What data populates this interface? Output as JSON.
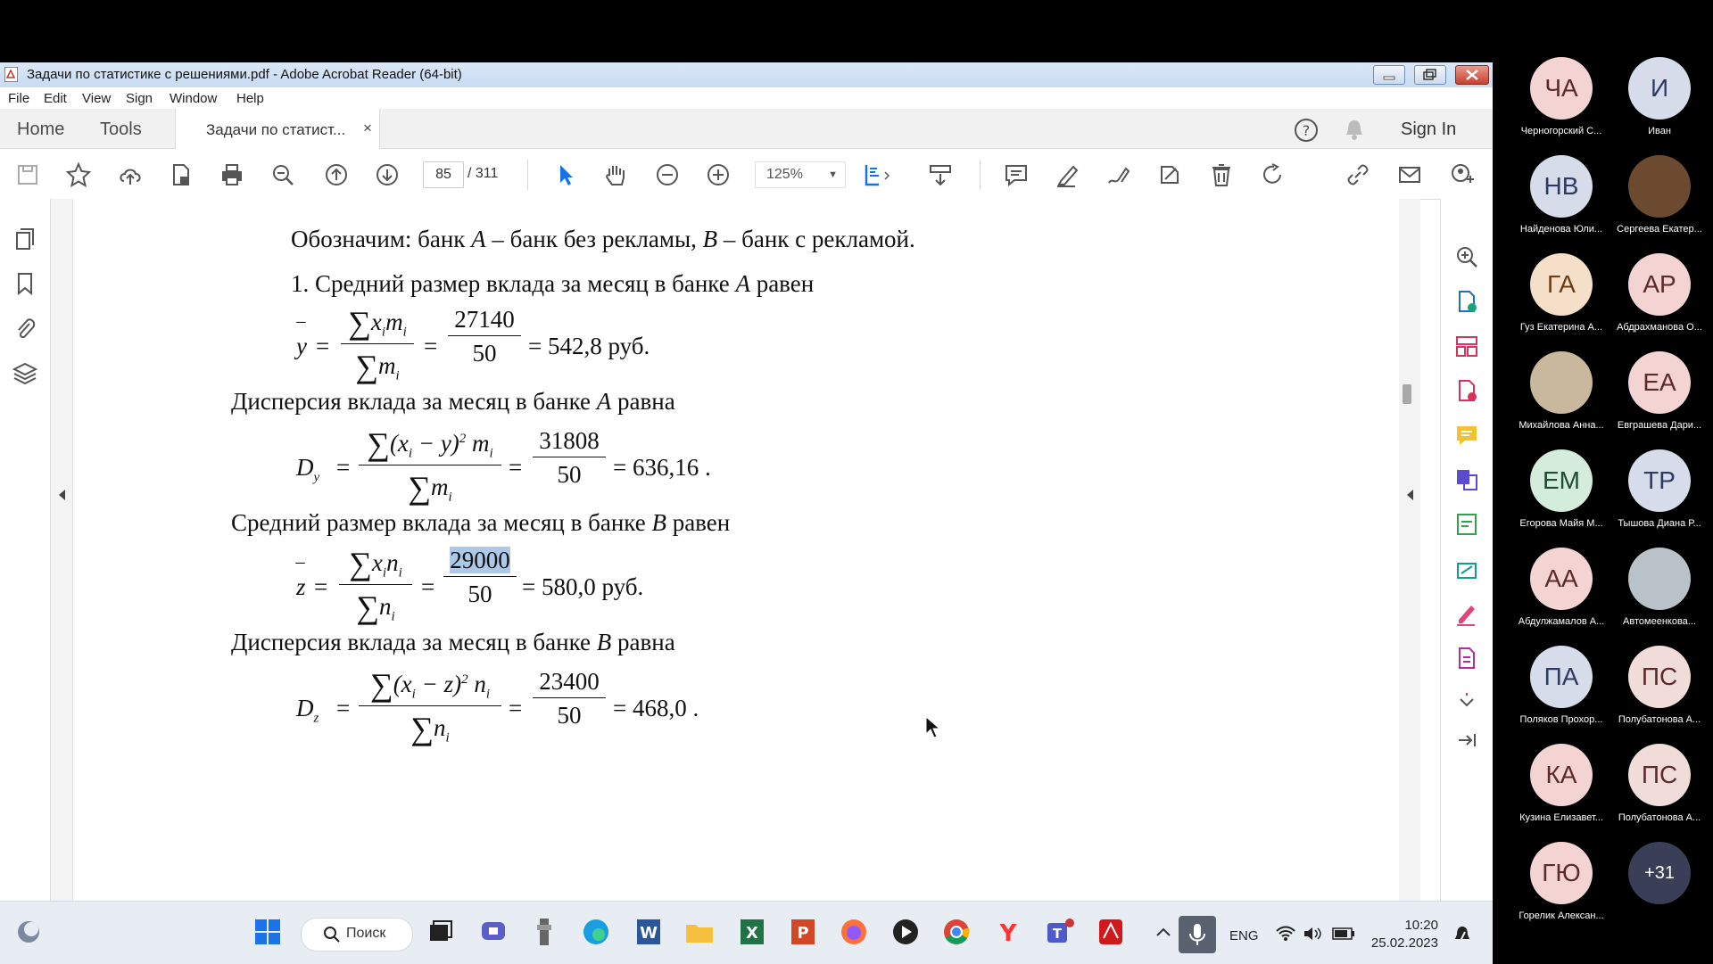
{
  "window": {
    "title": "Задачи по статистике с решениями.pdf - Adobe Acrobat Reader (64-bit)"
  },
  "menu": [
    "File",
    "Edit",
    "View",
    "Sign",
    "Window",
    "Help"
  ],
  "tabs": {
    "home": "Home",
    "tools": "Tools",
    "document": "Задачи по статист...",
    "close": "×",
    "sign_in": "Sign In"
  },
  "toolbar": {
    "page_current": "85",
    "page_total": "/  311",
    "zoom": "125%"
  },
  "document": {
    "line1_a": "Обозначим: банк ",
    "line1_A": "A",
    "line1_b": " – банк без рекламы, ",
    "line1_B": "B",
    "line1_c": " – банк с рекламой.",
    "line2_a": "1. Средний размер вклада за месяц в банке ",
    "line2_A": "A",
    "line2_b": " равен",
    "f1_result": "= 542,8  руб.",
    "f1_num": "27140",
    "f1_den": "50",
    "line3_a": "Дисперсия вклада за месяц в банке ",
    "line3_A": "A",
    "line3_b": " равна",
    "f2_num": "31808",
    "f2_den": "50",
    "f2_result": "= 636,16 .",
    "line4_a": "Средний размер вклада за месяц в банке ",
    "line4_B": "B",
    "line4_b": " равен",
    "f3_num": "29000",
    "f3_den": "50",
    "f3_result": "= 580,0  руб.",
    "line5_a": "Дисперсия вклада за месяц в банке ",
    "line5_B": "B",
    "line5_b": " равна",
    "f4_num": "23400",
    "f4_den": "50",
    "f4_result": "= 468,0 ."
  },
  "taskbar": {
    "search": "Поиск",
    "lang": "ENG",
    "time": "10:20",
    "date": "25.02.2023"
  },
  "participants": [
    {
      "initials": "ЧА",
      "name": "Черногорский С...",
      "color": "#f4d3d3"
    },
    {
      "initials": "И",
      "name": "Иван",
      "color": "#d6dcea"
    },
    {
      "initials": "НВ",
      "name": "Найденова Юли...",
      "color": "#d6dcea"
    },
    {
      "initials": "",
      "name": "Сергеева Екатер...",
      "color": "#6b4a2f"
    },
    {
      "initials": "ГА",
      "name": "Гуз Екатерина А...",
      "color": "#f6dfc8"
    },
    {
      "initials": "АР",
      "name": "Абдрахманова О...",
      "color": "#f4d3d3"
    },
    {
      "initials": "",
      "name": "Михайлова Анна...",
      "color": "#c9b89e"
    },
    {
      "initials": "ЕА",
      "name": "Евграшева Дари...",
      "color": "#f4d3d3"
    },
    {
      "initials": "ЕМ",
      "name": "Егорова Майя М...",
      "color": "#d3ecdc"
    },
    {
      "initials": "ТР",
      "name": "Тышова Диана Р...",
      "color": "#d6dcea"
    },
    {
      "initials": "АА",
      "name": "Абдулжамалов А...",
      "color": "#f4d3d3"
    },
    {
      "initials": "",
      "name": "Автомеенкова...",
      "color": "#b9c2c9"
    },
    {
      "initials": "ПА",
      "name": "Поляков Прохор...",
      "color": "#d6dcea"
    },
    {
      "initials": "ПС",
      "name": "Полубатонова А...",
      "color": "#f0dcd8"
    },
    {
      "initials": "КА",
      "name": "Кузина Елизавет...",
      "color": "#f4d3d3"
    },
    {
      "initials": "ПС",
      "name": "Полубатонова А...",
      "color": "#f0dcd8"
    },
    {
      "initials": "ГЮ",
      "name": "Горелик Алексан...",
      "color": "#f4d3d3"
    },
    {
      "initials": "+31",
      "name": "",
      "color": "#3a3f57"
    }
  ]
}
